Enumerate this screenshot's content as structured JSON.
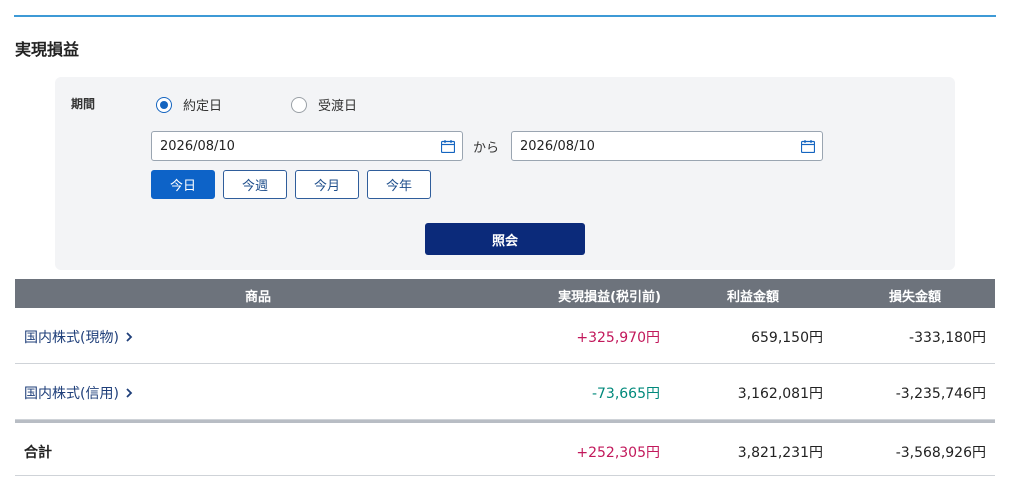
{
  "page": {
    "title": "実現損益"
  },
  "search": {
    "period_label": "期間",
    "radio_options": [
      {
        "label": "約定日",
        "checked": true
      },
      {
        "label": "受渡日",
        "checked": false
      }
    ],
    "date_from": "2026/08/10",
    "date_to": "2026/08/10",
    "range_separator": "から",
    "quick_buttons": [
      {
        "label": "今日",
        "active": true
      },
      {
        "label": "今週",
        "active": false
      },
      {
        "label": "今月",
        "active": false
      },
      {
        "label": "今年",
        "active": false
      }
    ],
    "submit_label": "照会"
  },
  "table": {
    "headers": {
      "product": "商品",
      "realized": "実現損益(税引前)",
      "profit": "利益金額",
      "loss": "損失金額"
    },
    "rows": [
      {
        "product": "国内株式(現物)",
        "realized": "+325,970円",
        "profit": "659,150円",
        "loss": "-333,180円"
      },
      {
        "product": "国内株式(信用)",
        "realized": "-73,665円",
        "profit": "3,162,081円",
        "loss": "-3,235,746円"
      }
    ],
    "total": {
      "label": "合計",
      "realized": "+252,305円",
      "profit": "3,821,231円",
      "loss": "-3,568,926円"
    }
  },
  "colors": {
    "accent_rule": "#3e9ad6",
    "positive": "#c2185b",
    "negative": "#00897b",
    "primary_button": "#0b2a7a",
    "active_quick_button": "#0d63c8",
    "table_header": "#6d737c"
  },
  "icons": {
    "date_picker": "calendar-icon",
    "row_link": "chevron-right-icon"
  }
}
